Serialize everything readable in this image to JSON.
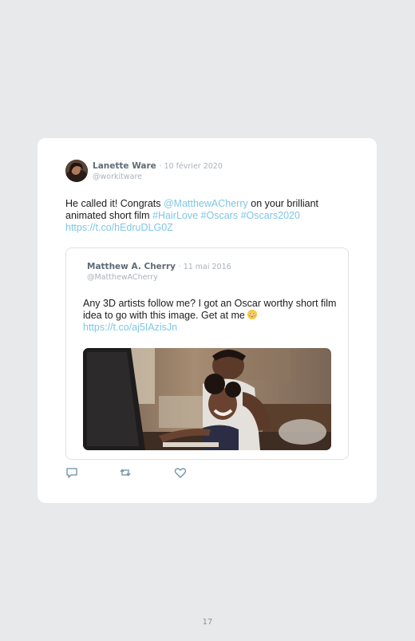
{
  "tweet": {
    "author_name": "Lanette Ware",
    "date": "· 10 février 2020",
    "handle": "@workitware",
    "text_parts": {
      "p1": "He called it! Congrats ",
      "mention": "@MatthewACherry",
      "p2": " on your brilliant animated short film ",
      "tag1": "#HairLove",
      "tag2": "#Oscars",
      "tag3": "#Oscars2020",
      "url": "https://t.co/hEdruDLG0Z"
    },
    "avatar_icon": "profile-photo"
  },
  "quoted_tweet": {
    "author_name": "Matthew A. Cherry",
    "date": "· 11 mai 2016",
    "handle": "@MatthewACherry",
    "text": "Any 3D artists follow me? I got an Oscar worthy short film idea to go with this image. Get at me",
    "emoji": "flushed-face-emoji",
    "url": "https://t.co/aj5IAzisJn",
    "image": "animated-father-daughter-at-computer"
  },
  "actions": {
    "reply_icon": "reply-icon",
    "retweet_icon": "retweet-icon",
    "like_icon": "heart-icon"
  },
  "colors": {
    "link": "#7ec6e6",
    "name": "#5f6b76",
    "muted": "#a9b2ba",
    "background": "#e8e9ea"
  },
  "page_number": "17"
}
